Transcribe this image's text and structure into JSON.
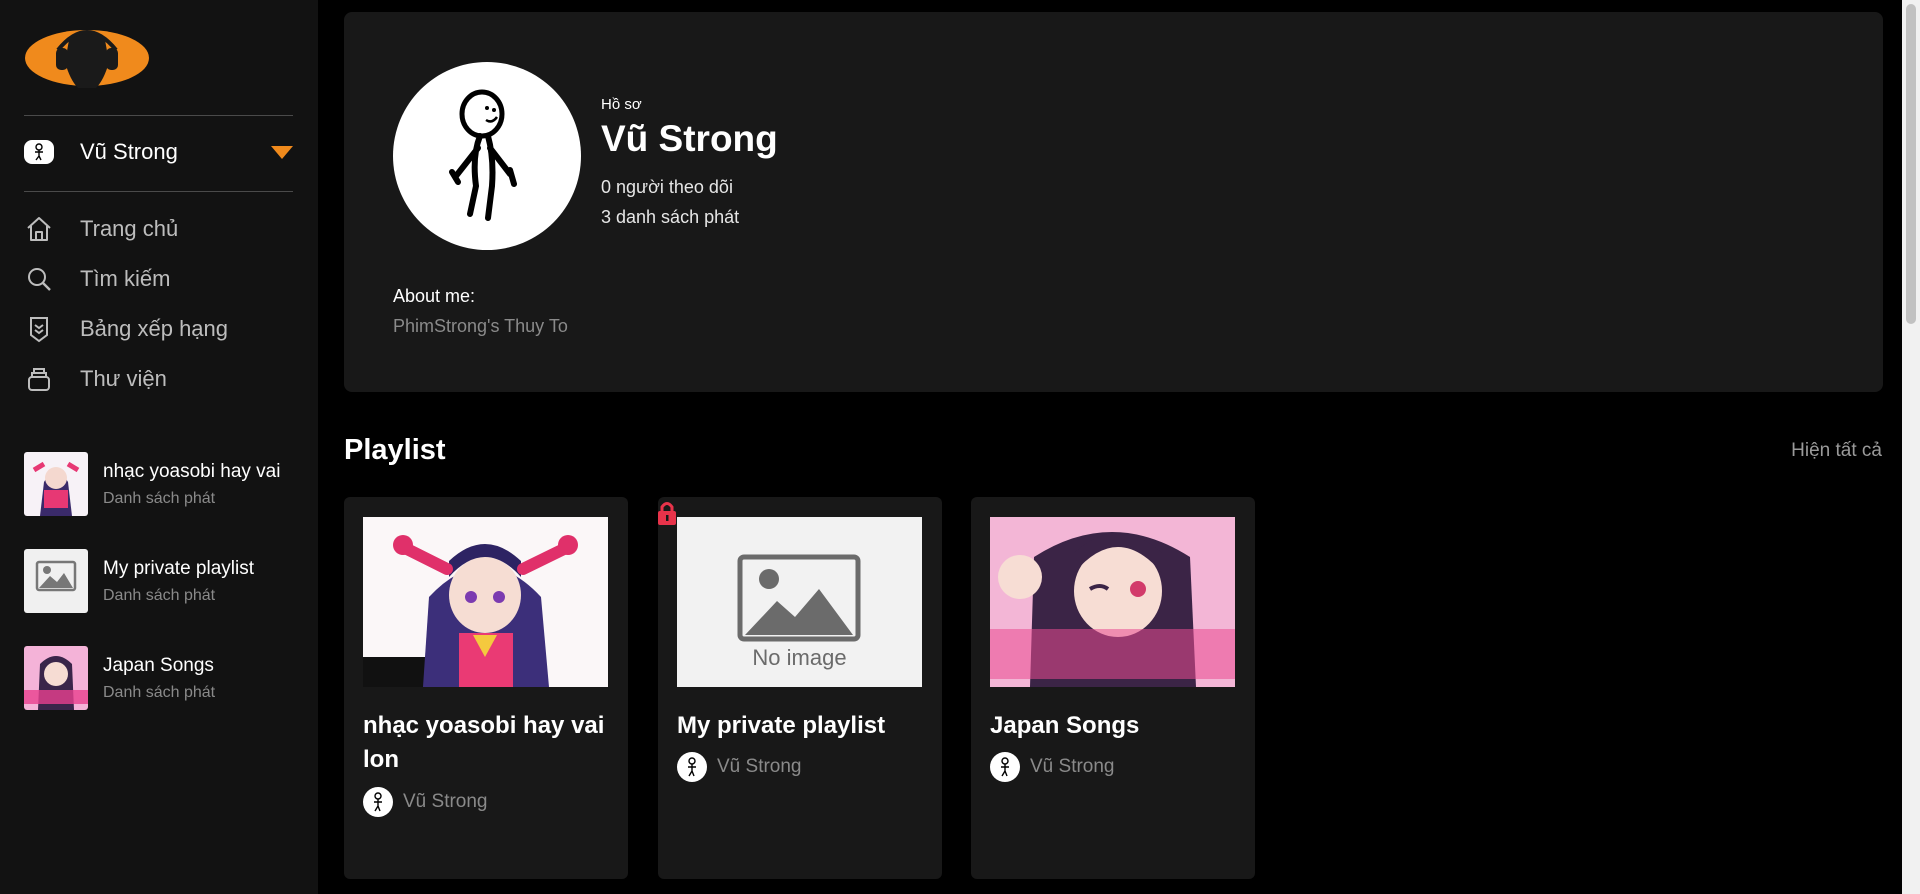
{
  "sidebar": {
    "user_name": "Vũ Strong",
    "nav": [
      {
        "label": "Trang chủ",
        "icon": "home-icon"
      },
      {
        "label": "Tìm kiếm",
        "icon": "search-icon"
      },
      {
        "label": "Bảng xếp hạng",
        "icon": "ranking-icon"
      },
      {
        "label": "Thư viện",
        "icon": "library-icon"
      }
    ],
    "playlists": [
      {
        "title": "nhạc yoasobi hay vai",
        "sub": "Danh sách phát"
      },
      {
        "title": "My private playlist",
        "sub": "Danh sách phát"
      },
      {
        "title": "Japan Songs",
        "sub": "Danh sách phát"
      }
    ]
  },
  "profile": {
    "kind": "Hồ sơ",
    "name": "Vũ Strong",
    "followers": "0 người theo dõi",
    "playlists": "3 danh sách phát",
    "about_label": "About me:",
    "about_text": "PhimStrong's Thuy To"
  },
  "playlist_section": {
    "title": "Playlist",
    "show_all": "Hiện tất cả",
    "cards": [
      {
        "title": "nhạc yoasobi hay vai lon",
        "owner": "Vũ Strong",
        "private": false
      },
      {
        "title": "My private playlist",
        "owner": "Vũ Strong",
        "private": true,
        "cover_text": "No image"
      },
      {
        "title": "Japan Songs",
        "owner": "Vũ Strong",
        "private": false
      }
    ]
  },
  "colors": {
    "accent": "#f08a1c",
    "lock": "#e8334a",
    "card_bg": "#181818",
    "sidebar_bg": "#121212"
  }
}
